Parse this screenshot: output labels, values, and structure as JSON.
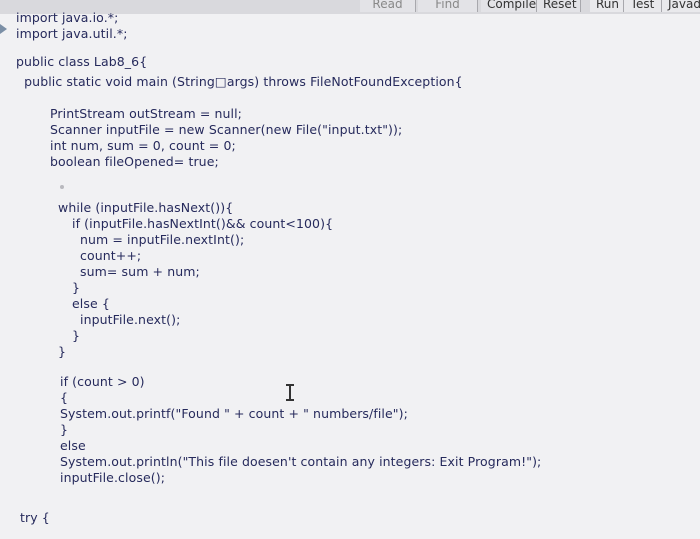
{
  "toolbar": {
    "read_label": "Read",
    "find_label": "Find",
    "compile_label": "Compile",
    "reset_label": "Reset",
    "run_label": "Run",
    "test_label": "Test",
    "javadoc_label": "Javadc"
  },
  "code": {
    "lines": [
      "import java.io.*;",
      "import java.util.*;",
      "public class Lab8_6{",
      "  public static void main (String□args) throws FileNotFoundException{",
      "PrintStream outStream = null;",
      "Scanner inputFile = new Scanner(new File(\"input.txt\"));",
      "int num, sum = 0, count = 0;",
      "boolean fileOpened= true;",
      "while (inputFile.hasNext()){",
      "if (inputFile.hasNextInt()&& count<100){",
      "num = inputFile.nextInt();",
      "count++;",
      "sum= sum + num;",
      "}",
      "else {",
      "inputFile.next();",
      "}",
      "}",
      "if (count > 0)",
      "{",
      "System.out.printf(\"Found \" + count + \" numbers/file\");",
      "}",
      "else",
      "System.out.println(\"This file doesen't contain any integers: Exit Program!\");",
      "inputFile.close();",
      "try {"
    ]
  }
}
